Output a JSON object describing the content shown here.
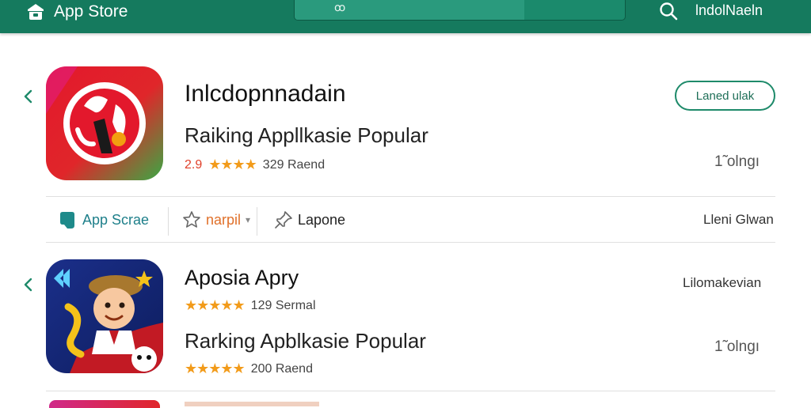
{
  "header": {
    "brand_label": "App Store",
    "search_text": "ꝏ",
    "user_name": "lndolNaeln"
  },
  "apps": [
    {
      "title": "Inlcdopnnadain",
      "subtitle": "Raiking Appllkasie Popular",
      "rating_text": "2.9",
      "stars": "★★★★",
      "count_text": "329  Raend",
      "action_label": "Laned ulak",
      "size_text": "1̃ olngı"
    },
    {
      "title": "Aposia Apry",
      "subtitle": "Rarking Apblkasie Popular",
      "stars_a": "★★★★★",
      "count_text_a": "1​29  Sermal",
      "stars_b": "★★★★★",
      "count_text_b": "200  Raend",
      "right_label": "Lilomakevian",
      "size_text": "1̃ olngı"
    }
  ],
  "action_row": {
    "app_store_label": "App Scrae",
    "rate_label": "narpil",
    "share_label": "Lapone",
    "right_label": "Lleni Glwan"
  },
  "colors": {
    "header_bg": "#157a5e",
    "accent": "#1e8a6a",
    "star": "#f29b1a"
  }
}
